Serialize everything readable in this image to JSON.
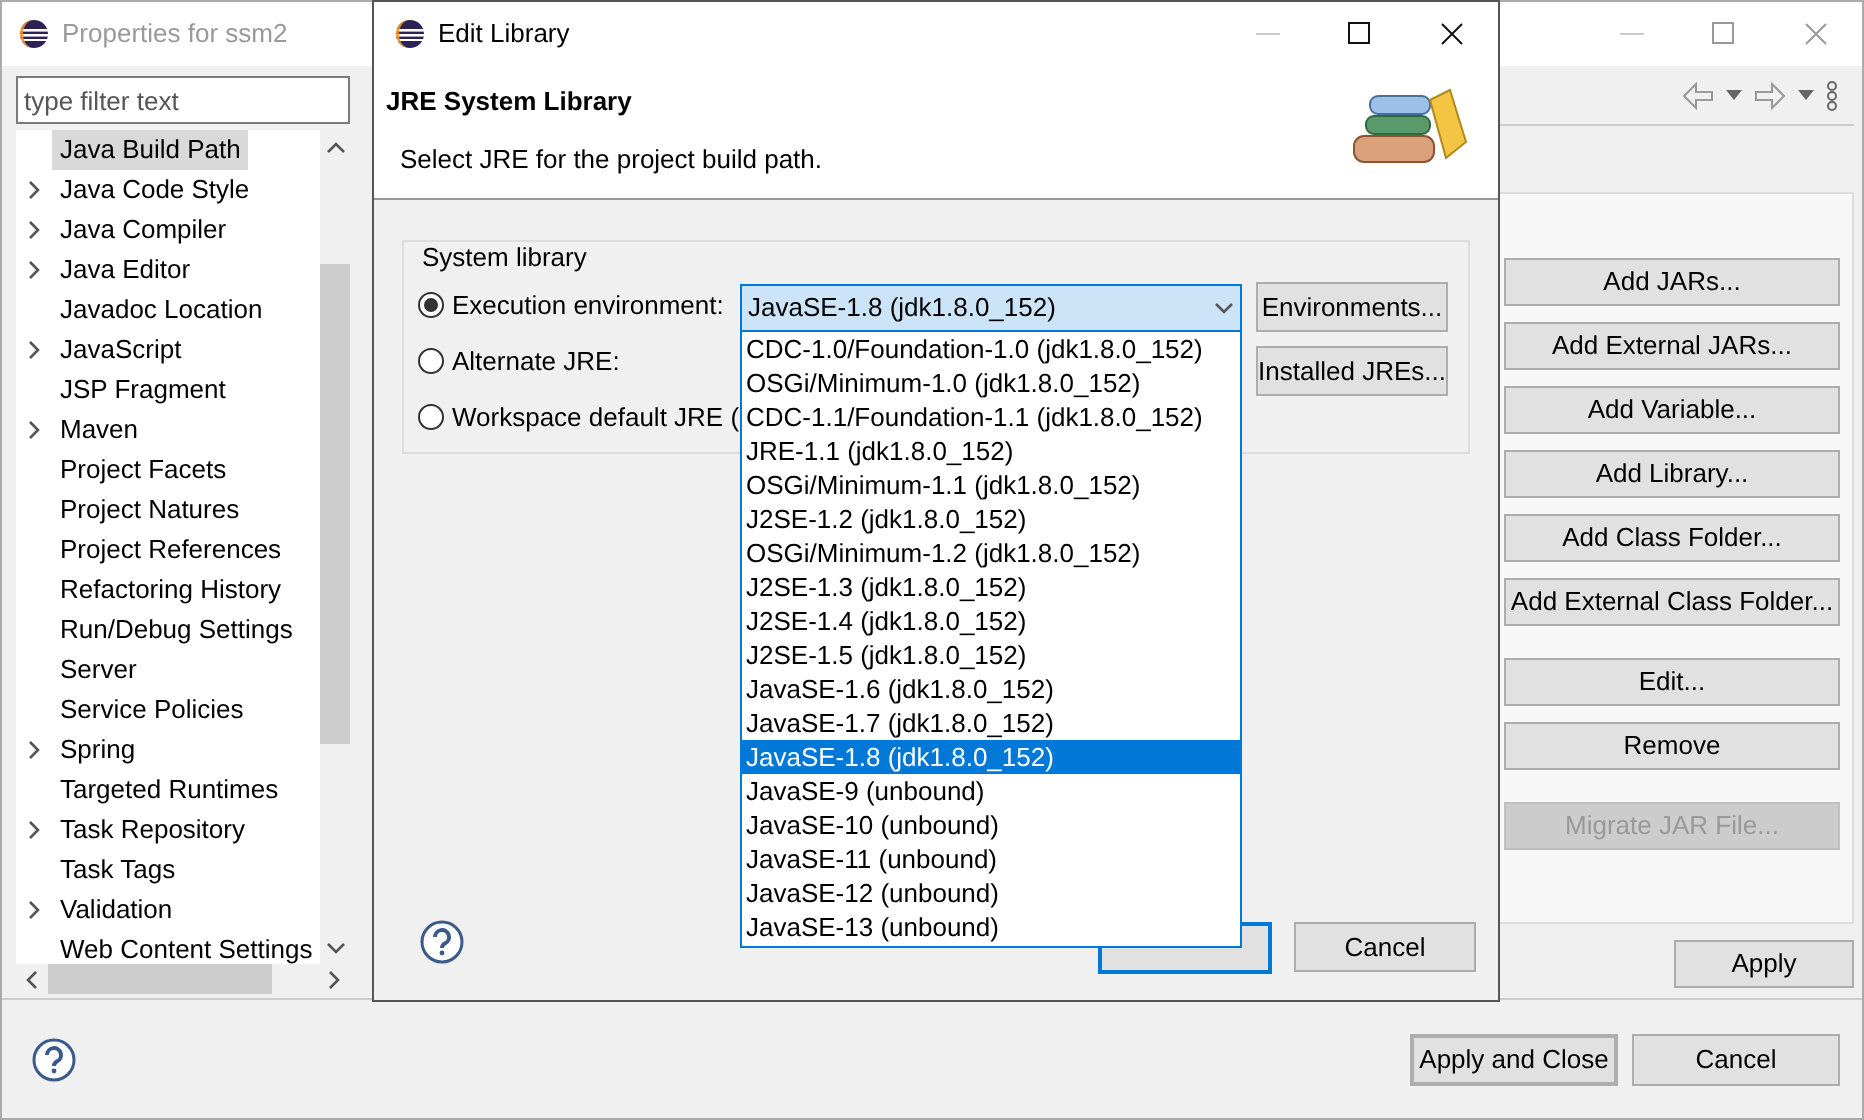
{
  "main_window": {
    "title": "Properties for ssm2",
    "active": false,
    "filter": {
      "placeholder": "type filter text"
    },
    "tree": [
      {
        "label": "Java Build Path",
        "expandable": false,
        "selected": true
      },
      {
        "label": "Java Code Style",
        "expandable": true,
        "selected": false
      },
      {
        "label": "Java Compiler",
        "expandable": true,
        "selected": false
      },
      {
        "label": "Java Editor",
        "expandable": true,
        "selected": false
      },
      {
        "label": "Javadoc Location",
        "expandable": false,
        "selected": false
      },
      {
        "label": "JavaScript",
        "expandable": true,
        "selected": false
      },
      {
        "label": "JSP Fragment",
        "expandable": false,
        "selected": false
      },
      {
        "label": "Maven",
        "expandable": true,
        "selected": false
      },
      {
        "label": "Project Facets",
        "expandable": false,
        "selected": false
      },
      {
        "label": "Project Natures",
        "expandable": false,
        "selected": false
      },
      {
        "label": "Project References",
        "expandable": false,
        "selected": false
      },
      {
        "label": "Refactoring History",
        "expandable": false,
        "selected": false
      },
      {
        "label": "Run/Debug Settings",
        "expandable": false,
        "selected": false
      },
      {
        "label": "Server",
        "expandable": false,
        "selected": false
      },
      {
        "label": "Service Policies",
        "expandable": false,
        "selected": false
      },
      {
        "label": "Spring",
        "expandable": true,
        "selected": false
      },
      {
        "label": "Targeted Runtimes",
        "expandable": false,
        "selected": false
      },
      {
        "label": "Task Repository",
        "expandable": true,
        "selected": false
      },
      {
        "label": "Task Tags",
        "expandable": false,
        "selected": false
      },
      {
        "label": "Validation",
        "expandable": true,
        "selected": false
      },
      {
        "label": "Web Content Settings",
        "expandable": false,
        "selected": false
      }
    ],
    "button_groups": [
      [
        {
          "label": "Add JARs...",
          "disabled": false
        },
        {
          "label": "Add External JARs...",
          "disabled": false
        },
        {
          "label": "Add Variable...",
          "disabled": false
        },
        {
          "label": "Add Library...",
          "disabled": false
        },
        {
          "label": "Add Class Folder...",
          "disabled": false
        },
        {
          "label": "Add External Class Folder...",
          "disabled": false
        }
      ],
      [
        {
          "label": "Edit...",
          "disabled": false
        },
        {
          "label": "Remove",
          "disabled": false
        }
      ],
      [
        {
          "label": "Migrate JAR File...",
          "disabled": true
        }
      ]
    ],
    "apply": "Apply",
    "footer_buttons": [
      {
        "label": "Apply and Close",
        "default": true
      },
      {
        "label": "Cancel",
        "default": false
      }
    ]
  },
  "dialog": {
    "title": "Edit Library",
    "header_title": "JRE System Library",
    "header_subtitle": "Select JRE for the project build path.",
    "group_label": "System library",
    "options": [
      {
        "label": "Execution environment:",
        "selected": true
      },
      {
        "label": "Alternate JRE:",
        "selected": false
      },
      {
        "label": "Workspace default JRE (",
        "selected": false
      }
    ],
    "combo_value": "JavaSE-1.8 (jdk1.8.0_152)",
    "side_buttons": [
      "Environments...",
      "Installed JREs..."
    ],
    "dropdown": [
      {
        "label": "CDC-1.0/Foundation-1.0 (jdk1.8.0_152)",
        "selected": false
      },
      {
        "label": "OSGi/Minimum-1.0 (jdk1.8.0_152)",
        "selected": false
      },
      {
        "label": "CDC-1.1/Foundation-1.1 (jdk1.8.0_152)",
        "selected": false
      },
      {
        "label": "JRE-1.1 (jdk1.8.0_152)",
        "selected": false
      },
      {
        "label": "OSGi/Minimum-1.1 (jdk1.8.0_152)",
        "selected": false
      },
      {
        "label": "J2SE-1.2 (jdk1.8.0_152)",
        "selected": false
      },
      {
        "label": "OSGi/Minimum-1.2 (jdk1.8.0_152)",
        "selected": false
      },
      {
        "label": "J2SE-1.3 (jdk1.8.0_152)",
        "selected": false
      },
      {
        "label": "J2SE-1.4 (jdk1.8.0_152)",
        "selected": false
      },
      {
        "label": "J2SE-1.5 (jdk1.8.0_152)",
        "selected": false
      },
      {
        "label": "JavaSE-1.6 (jdk1.8.0_152)",
        "selected": false
      },
      {
        "label": "JavaSE-1.7 (jdk1.8.0_152)",
        "selected": false
      },
      {
        "label": "JavaSE-1.8 (jdk1.8.0_152)",
        "selected": true
      },
      {
        "label": "JavaSE-9 (unbound)",
        "selected": false
      },
      {
        "label": "JavaSE-10 (unbound)",
        "selected": false
      },
      {
        "label": "JavaSE-11 (unbound)",
        "selected": false
      },
      {
        "label": "JavaSE-12 (unbound)",
        "selected": false
      },
      {
        "label": "JavaSE-13 (unbound)",
        "selected": false
      }
    ],
    "cancel": "Cancel"
  }
}
